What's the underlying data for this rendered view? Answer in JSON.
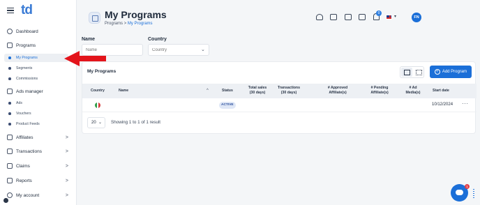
{
  "app": {
    "logo": "td"
  },
  "sidebar": {
    "items": [
      {
        "label": "Dashboard",
        "icon": "dashboard-icon"
      },
      {
        "label": "Programs",
        "icon": "programs-icon"
      },
      {
        "label": "Ads manager",
        "icon": "ads-manager-icon"
      },
      {
        "label": "Affiliates",
        "icon": "affiliates-icon"
      },
      {
        "label": "Transactions",
        "icon": "transactions-icon"
      },
      {
        "label": "Claims",
        "icon": "claims-icon"
      },
      {
        "label": "Reports",
        "icon": "reports-icon"
      },
      {
        "label": "My account",
        "icon": "account-icon"
      }
    ],
    "programs_sub": [
      "My Programs",
      "Segments",
      "Commissions"
    ],
    "ads_sub": [
      "Ads",
      "Vouchers",
      "Product Feeds"
    ],
    "chevron": ">"
  },
  "header": {
    "title": "My Programs",
    "breadcrumb_root": "Programs",
    "breadcrumb_sep": ">",
    "breadcrumb_current": "My Programs",
    "notification_count": "0",
    "language_chevron": "▾",
    "avatar_initials": "FN"
  },
  "filters": {
    "name_label": "Name",
    "name_placeholder": "Name",
    "country_label": "Country",
    "country_placeholder": "Country",
    "chevron": "⌄"
  },
  "card": {
    "title": "My Programs",
    "add_button": "Add Program",
    "add_plus": "+",
    "columns": {
      "country": "Country",
      "name": "Name",
      "status": "Status",
      "total_sales": "Total sales (30 days)",
      "transactions": "Transactions (30 days)",
      "approved": "# Approved Affiliate(s)",
      "pending": "# Pending Affiliate(s)",
      "ad_media": "# Ad Media(s)",
      "start_date": "Start date"
    },
    "sort_indicator": "^",
    "rows": [
      {
        "country_flag": "IT",
        "name": "",
        "status": "ACTIVE",
        "start_date": "10/12/2024",
        "more": "···"
      }
    ],
    "page_size": "20",
    "page_size_chevron": "⌄",
    "showing": "Showing 1 to 1 of 1 result"
  },
  "chat": {
    "badge": "1"
  },
  "colors": {
    "accent": "#1b6fd8",
    "annotation_arrow": "#e3141b"
  }
}
